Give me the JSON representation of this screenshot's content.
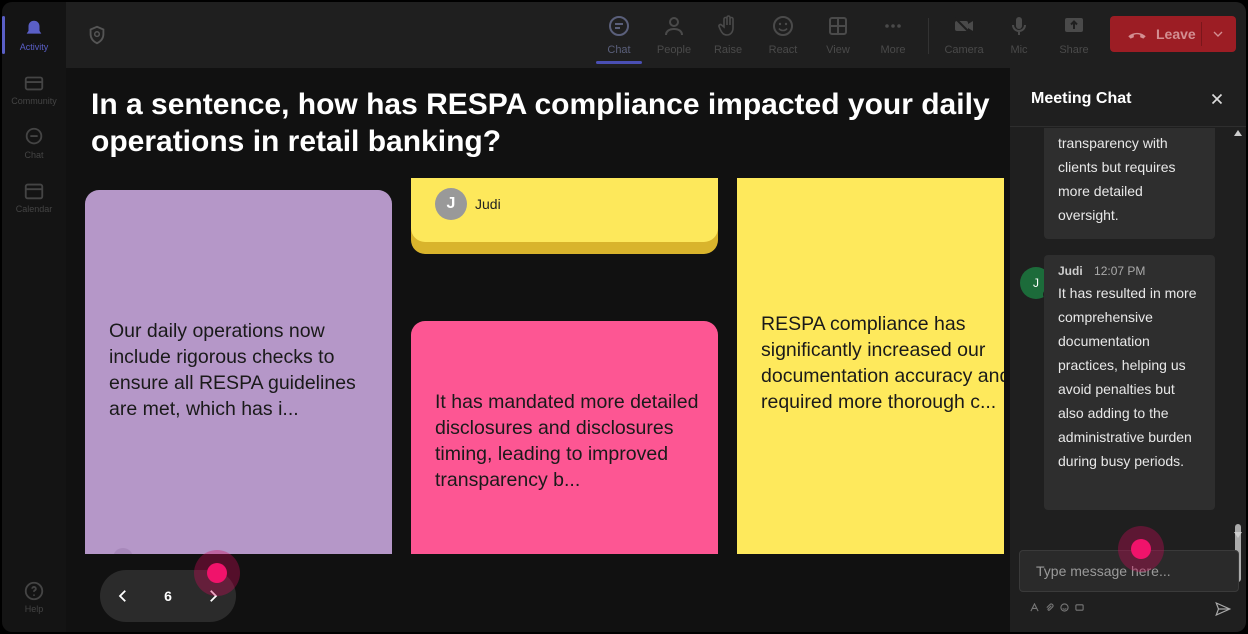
{
  "rail": {
    "items": [
      {
        "label": "Activity",
        "icon": "bell-icon",
        "active": true
      },
      {
        "label": "Community",
        "icon": "community-icon"
      },
      {
        "label": "Chat",
        "icon": "chat-icon"
      },
      {
        "label": "Calendar",
        "icon": "calendar-icon"
      }
    ],
    "help": "Help"
  },
  "toolbar": {
    "chat": "Chat",
    "people": "People",
    "raise": "Raise",
    "react": "React",
    "view": "View",
    "more": "More",
    "camera": "Camera",
    "mic": "Mic",
    "share": "Share",
    "leave": "Leave",
    "accent": "#4a4fb4",
    "leave_color": "#9c1d24"
  },
  "stage": {
    "question": "In a sentence, how has RESPA compliance impacted your daily operations in retail banking?",
    "cards": [
      {
        "text": "Our daily operations now include rigorous checks to ensure all RESPA guidelines are met, which has i...",
        "color": "#b597c8"
      },
      {
        "author_initial": "J",
        "author": "Judi",
        "color": "#fde85b"
      },
      {
        "text": "It has mandated more detailed disclosures and disclosures timing, leading to improved transparency b...",
        "color": "#fd5693"
      },
      {
        "text": "RESPA compliance has significantly increased our documentation accuracy and required more thorough c...",
        "color": "#fee95c"
      }
    ],
    "pager": {
      "page": "6"
    }
  },
  "chat": {
    "title": "Meeting Chat",
    "messages": [
      {
        "text": "transparency with clients but requires more detailed oversight."
      },
      {
        "initial": "J",
        "author": "Judi",
        "time": "12:07 PM",
        "text": "It has resulted in more comprehensive documentation practices, helping us avoid penalties but also adding to the administrative burden during busy periods."
      }
    ],
    "input_placeholder": "Type message here..."
  }
}
